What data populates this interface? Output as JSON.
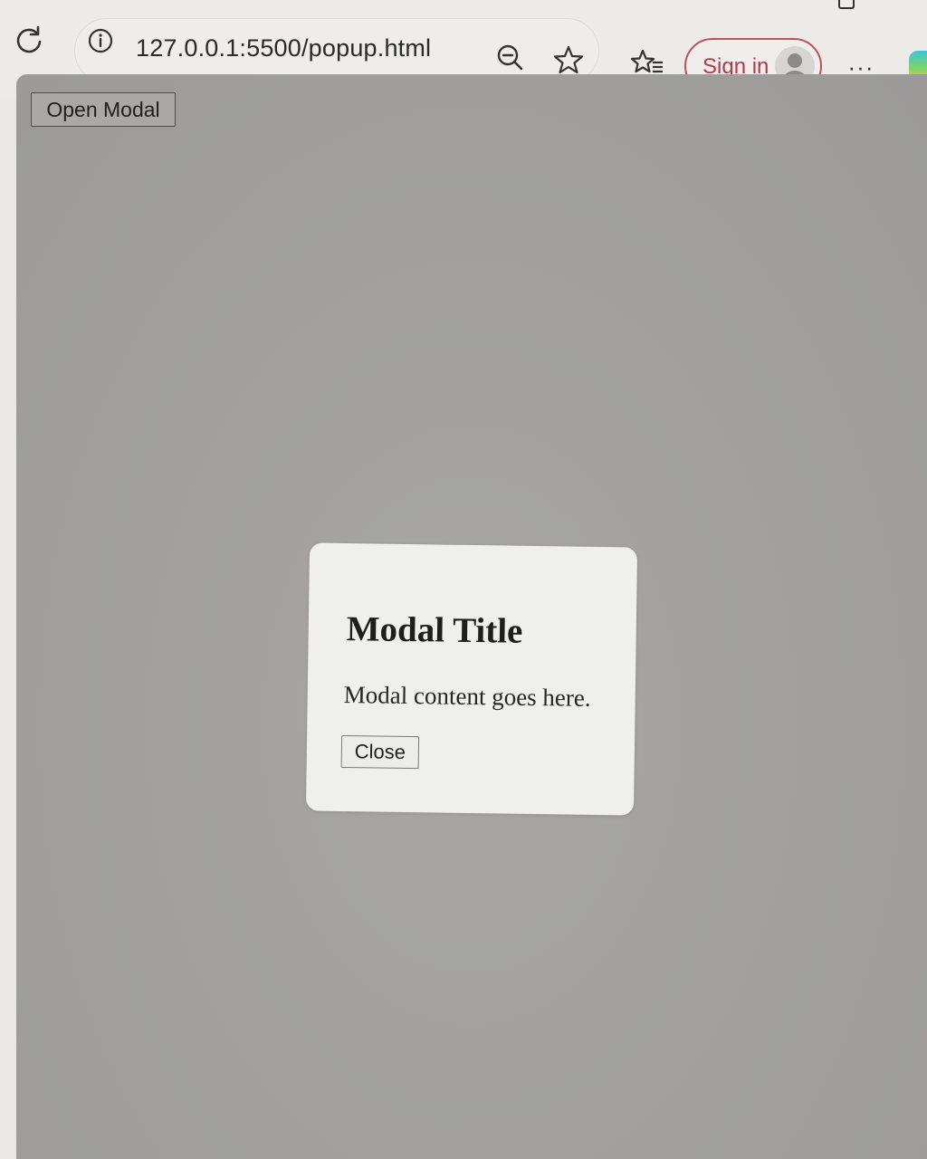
{
  "browser": {
    "url": "127.0.0.1:5500/popup.html",
    "sign_in_label": "Sign in",
    "more_label": "···",
    "accent_color": "#b23a48"
  },
  "page": {
    "open_modal_label": "Open Modal",
    "overlay_color": "#a2a19f"
  },
  "modal": {
    "title": "Modal Title",
    "content": "Modal content goes here.",
    "close_label": "Close"
  }
}
